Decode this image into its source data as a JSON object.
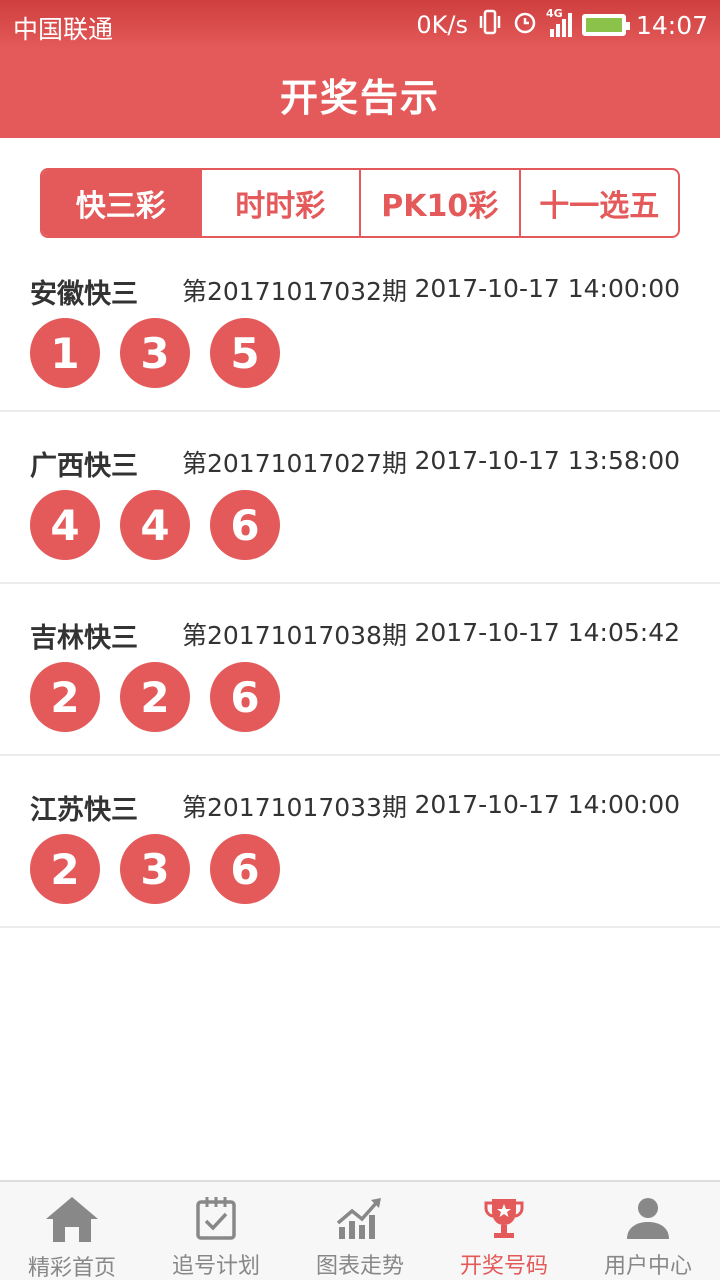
{
  "status_bar": {
    "carrier": "中国联通",
    "speed": "0K/s",
    "network": "4G",
    "time": "14:07"
  },
  "header": {
    "title": "开奖告示"
  },
  "tabs": [
    {
      "label": "快三彩",
      "active": true
    },
    {
      "label": "时时彩",
      "active": false
    },
    {
      "label": "PK10彩",
      "active": false
    },
    {
      "label": "十一选五",
      "active": false
    }
  ],
  "results": [
    {
      "name": "安徽快三",
      "period": "第20171017032期",
      "time": "2017-10-17 14:00:00",
      "balls": [
        "1",
        "3",
        "5"
      ]
    },
    {
      "name": "广西快三",
      "period": "第20171017027期",
      "time": "2017-10-17 13:58:00",
      "balls": [
        "4",
        "4",
        "6"
      ]
    },
    {
      "name": "吉林快三",
      "period": "第20171017038期",
      "time": "2017-10-17 14:05:42",
      "balls": [
        "2",
        "2",
        "6"
      ]
    },
    {
      "name": "江苏快三",
      "period": "第20171017033期",
      "time": "2017-10-17 14:00:00",
      "balls": [
        "2",
        "3",
        "6"
      ]
    }
  ],
  "bottom_nav": [
    {
      "label": "精彩首页",
      "icon": "home-icon",
      "active": false
    },
    {
      "label": "追号计划",
      "icon": "calendar-check-icon",
      "active": false
    },
    {
      "label": "图表走势",
      "icon": "chart-trend-icon",
      "active": false
    },
    {
      "label": "开奖号码",
      "icon": "trophy-icon",
      "active": true
    },
    {
      "label": "用户中心",
      "icon": "user-icon",
      "active": false
    }
  ],
  "colors": {
    "accent": "#e45a5a",
    "nav_inactive": "#888888"
  }
}
